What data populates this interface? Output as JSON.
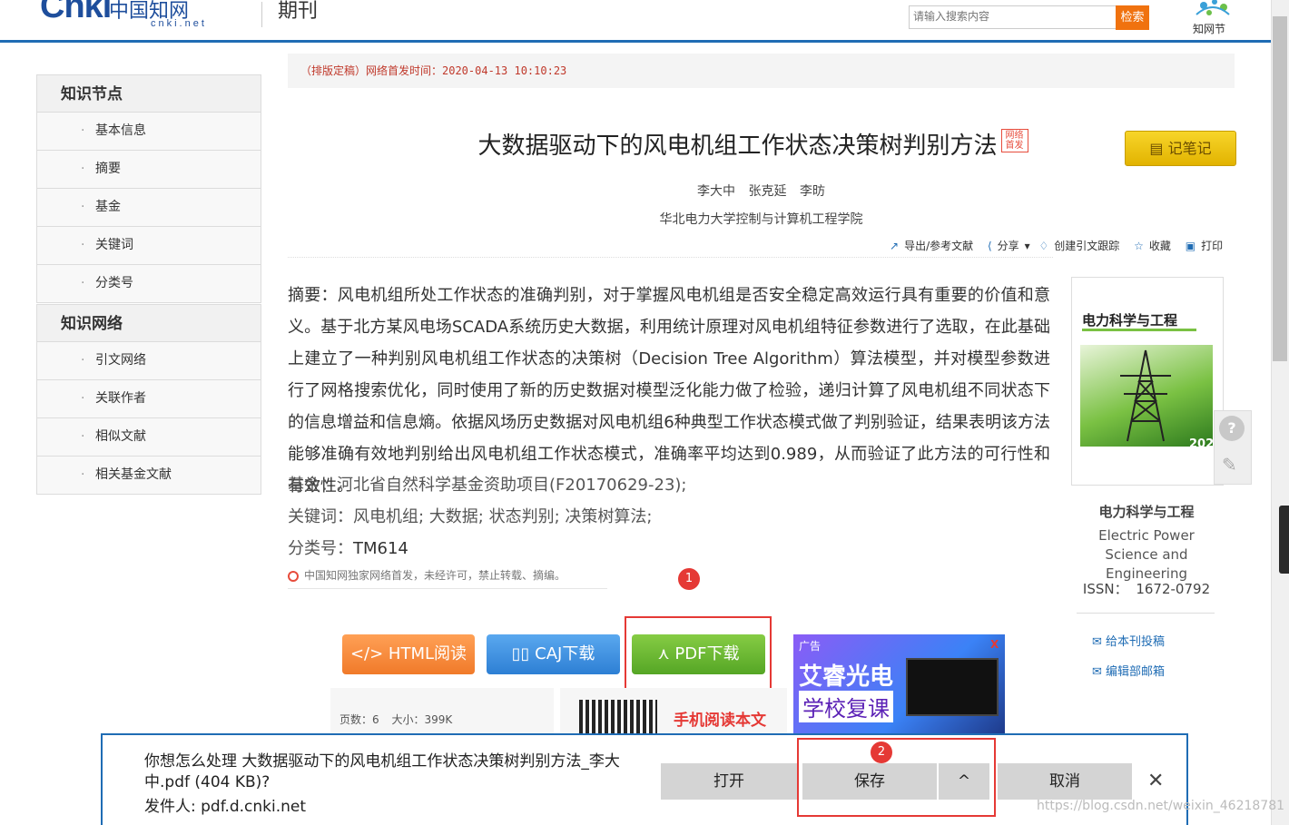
{
  "header": {
    "logo_text": "Cnki",
    "logo_cn": "中国知网",
    "logo_sub": "cnki.net",
    "section": "期刊",
    "search_placeholder": "请输入搜索内容",
    "search_button": "检索",
    "zhiwang_label": "知网节"
  },
  "sidebar": {
    "sections": [
      {
        "title": "知识节点",
        "items": [
          "基本信息",
          "摘要",
          "基金",
          "关键词",
          "分类号"
        ]
      },
      {
        "title": "知识网络",
        "items": [
          "引文网络",
          "关联作者",
          "相似文献",
          "相关基金文献"
        ]
      }
    ]
  },
  "article": {
    "pub_time": "（排版定稿）网络首发时间：2020-04-13 10:10:23",
    "title": "大数据驱动下的风电机组工作状态决策树判别方法",
    "badge": "网络首发",
    "note_button": "记笔记",
    "authors": "李大中 张克延 李昉",
    "affiliation": "华北电力大学控制与计算机工程学院",
    "toolbar": [
      "导出/参考文献",
      "分享",
      "创建引文跟踪",
      "收藏",
      "打印"
    ],
    "abstract": "摘要：风电机组所处工作状态的准确判别，对于掌握风电机组是否安全稳定高效运行具有重要的价值和意义。基于北方某风电场SCADA系统历史大数据，利用统计原理对风电机组特征参数进行了选取，在此基础上建立了一种判别风电机组工作状态的决策树（Decision Tree Algorithm）算法模型，并对模型参数进行了网格搜索优化，同时使用了新的历史数据对模型泛化能力做了检验，递归计算了风电机组不同状态下的信息增益和信息熵。依据风场历史数据对风电机组6种典型工作状态模式做了判别验证，结果表明该方法能够准确有效地判别给出风电机组工作状态模式，准确率平均达到0.989，从而验证了此方法的可行性和有效性。",
    "fund": "基金：河北省自然科学基金资助项目(F20170629-23);",
    "keywords": "关键词：风电机组; 大数据; 状态判别; 决策树算法;",
    "class_no_label": "分类号：",
    "class_no": "TM614",
    "exclusive": "中国知网独家网络首发，未经许可，禁止转载、摘编。"
  },
  "downloads": {
    "html": "</> HTML阅读",
    "caj": "CAJ下载",
    "pdf": "PDF下载",
    "pages": "页数：6",
    "size": "大小：399K",
    "mobile_read": "手机阅读本文"
  },
  "ad": {
    "tag": "广告",
    "close": "X",
    "line1": "艾睿光电",
    "line2": "学校复课"
  },
  "journal": {
    "cover_title": "电力科学与工程",
    "cover_issue": "2020 01",
    "name": "电力科学与工程",
    "name_en": "Electric Power Science and Engineering",
    "issn": "ISSN： 1672-0792",
    "links": [
      "给本刊投稿",
      "编辑部邮箱"
    ]
  },
  "markers": [
    "1",
    "2"
  ],
  "download_bar": {
    "message": "你想怎么处理 大数据驱动下的风电机组工作状态决策树判别方法_李大中.pdf (404 KB)?",
    "from": "发件人: pdf.d.cnki.net",
    "open": "打开",
    "save": "保存",
    "save_menu": "^",
    "cancel": "取消",
    "close": "✕"
  },
  "watermark": "https://blog.csdn.net/weixin_46218781",
  "colors": {
    "accent": "#1f6cb4",
    "highlight": "#e53935",
    "search": "#f0720f"
  }
}
